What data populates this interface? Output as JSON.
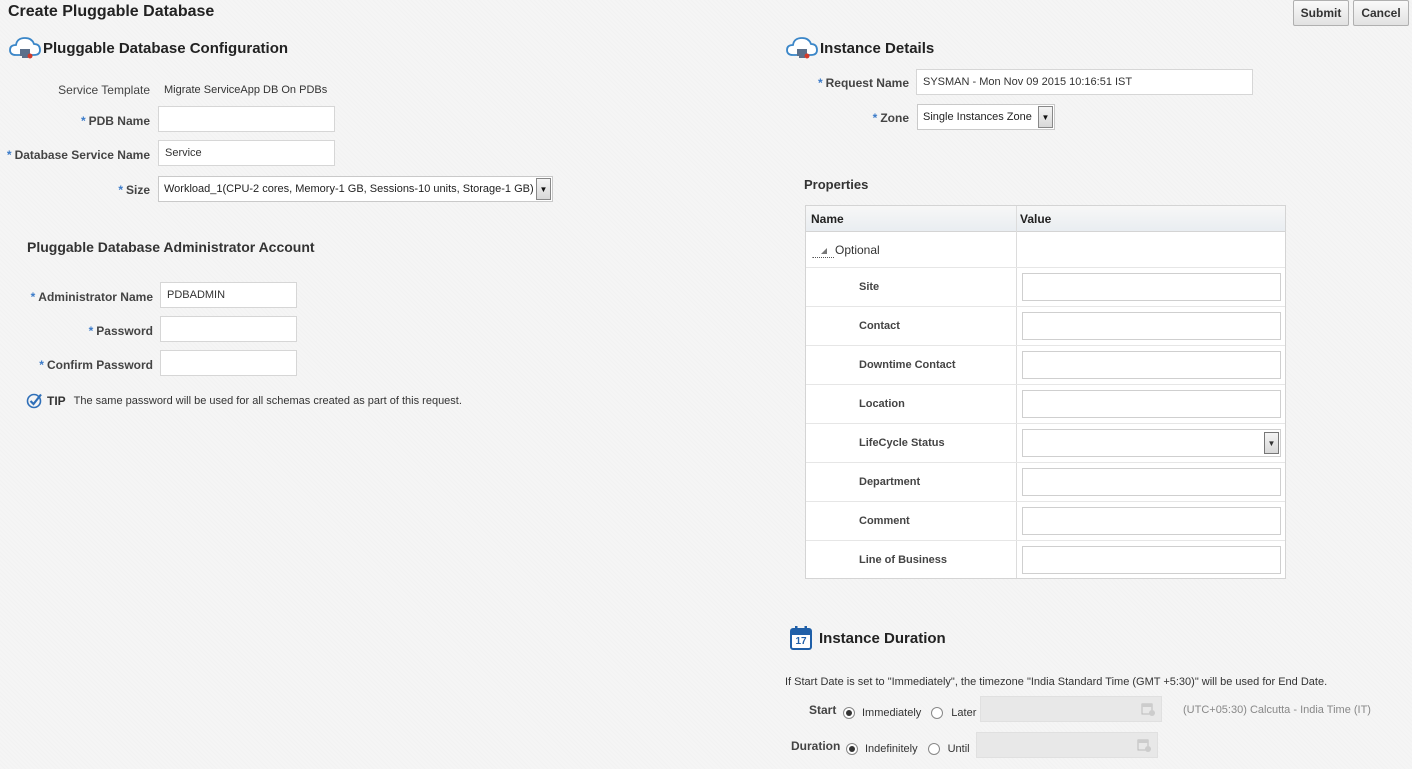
{
  "page": {
    "title": "Create Pluggable Database"
  },
  "toolbar": {
    "submit_label": "Submit",
    "cancel_label": "Cancel"
  },
  "pdb_config": {
    "title": "Pluggable Database Configuration",
    "service_template_label": "Service Template",
    "service_template_value": "Migrate ServiceApp DB On PDBs",
    "pdb_name_label": "PDB Name",
    "pdb_name_value": "",
    "service_name_label": "Database Service Name",
    "service_name_value": "Service",
    "size_label": "Size",
    "size_value": "Workload_1(CPU-2 cores, Memory-1 GB, Sessions-10 units, Storage-1 GB)"
  },
  "admin": {
    "title": "Pluggable Database Administrator Account",
    "name_label": "Administrator Name",
    "name_value": "PDBADMIN",
    "password_label": "Password",
    "confirm_label": "Confirm Password",
    "tip_label": "TIP",
    "tip_text": "The same password will be used for all schemas created as part of this request."
  },
  "instance": {
    "title": "Instance Details",
    "request_name_label": "Request Name",
    "request_name_value": "SYSMAN - Mon Nov 09 2015 10:16:51 IST",
    "zone_label": "Zone",
    "zone_value": "Single Instances Zone"
  },
  "properties": {
    "title": "Properties",
    "col_name": "Name",
    "col_value": "Value",
    "group_label": "Optional",
    "rows": [
      {
        "name": "Site",
        "type": "input"
      },
      {
        "name": "Contact",
        "type": "input"
      },
      {
        "name": "Downtime Contact",
        "type": "input"
      },
      {
        "name": "Location",
        "type": "input"
      },
      {
        "name": "LifeCycle Status",
        "type": "select"
      },
      {
        "name": "Department",
        "type": "input"
      },
      {
        "name": "Comment",
        "type": "input"
      },
      {
        "name": "Line of Business",
        "type": "input"
      }
    ]
  },
  "duration": {
    "title": "Instance Duration",
    "calendar_day": "17",
    "note": "If Start Date is set to \"Immediately\", the timezone \"India Standard Time (GMT +5:30)\" will be used for End Date.",
    "start_label": "Start",
    "start_immediately": "Immediately",
    "start_later": "Later",
    "timezone": "(UTC+05:30) Calcutta - India Time (IT)",
    "duration_label": "Duration",
    "duration_indefinitely": "Indefinitely",
    "duration_until": "Until"
  }
}
